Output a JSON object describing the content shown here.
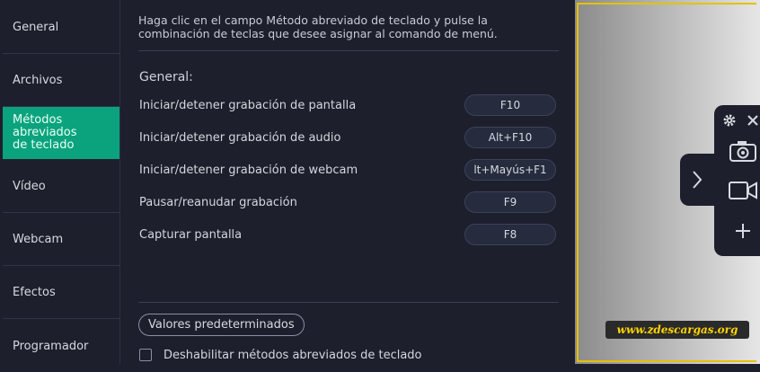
{
  "sidebar": {
    "items": [
      {
        "label": "General"
      },
      {
        "label": "Archivos"
      },
      {
        "label": "Métodos abreviados de teclado"
      },
      {
        "label": "Vídeo"
      },
      {
        "label": "Webcam"
      },
      {
        "label": "Efectos"
      },
      {
        "label": "Programador"
      }
    ]
  },
  "main": {
    "hint": "Haga clic en el campo Método abreviado de teclado y pulse la combinación de teclas que desee asignar al comando de menú.",
    "section_title": "General:",
    "shortcuts": [
      {
        "label": "Iniciar/detener grabación de pantalla",
        "key": "F10"
      },
      {
        "label": "Iniciar/detener grabación de audio",
        "key": "Alt+F10"
      },
      {
        "label": "Iniciar/detener grabación de webcam",
        "key": "lt+Mayús+F1"
      },
      {
        "label": "Pausar/reanudar grabación",
        "key": "F9"
      },
      {
        "label": "Capturar pantalla",
        "key": "F8"
      }
    ],
    "defaults_button": "Valores predeterminados",
    "disable_checkbox_label": "Deshabilitar métodos abreviados de teclado"
  },
  "preview": {
    "watermark": "www.zdescargas.org"
  },
  "colors": {
    "background": "#1d1f2c",
    "accent": "#0aa37d",
    "frame": "#e4c100"
  },
  "icons": [
    "gear-icon",
    "close-icon",
    "camera-icon",
    "video-camera-icon",
    "plus-icon",
    "chevron-right-icon"
  ]
}
